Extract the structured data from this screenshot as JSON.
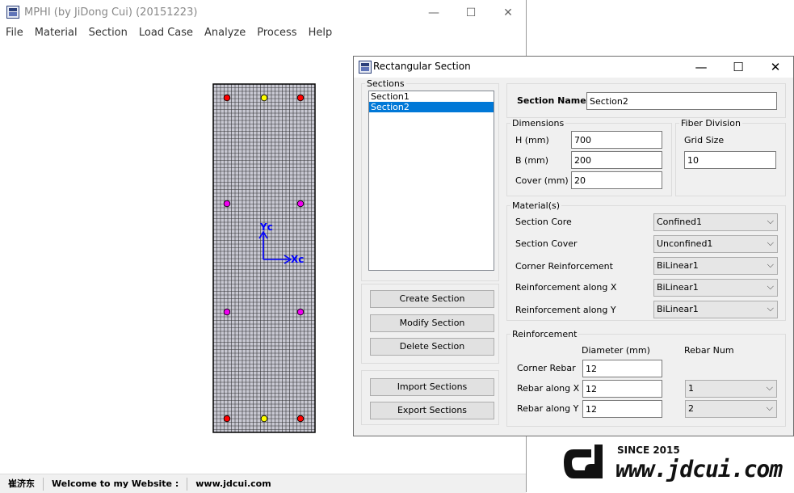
{
  "main_window": {
    "title": "MPHI (by JiDong Cui) (20151223)",
    "controls": {
      "minimize": "—",
      "maximize": "☐",
      "close": "✕"
    },
    "menu": [
      "File",
      "Material",
      "Section",
      "Load Case",
      "Analyze",
      "Process",
      "Help"
    ],
    "canvas": {
      "axis_y_label": "Yc",
      "axis_x_label": "Xc",
      "colors": {
        "concrete": "#c8c8d2",
        "grid": "#000000",
        "corner_rebar": "#ff0000",
        "rebar_x": "#ffff00",
        "rebar_y": "#ee00ee",
        "axis": "#0000ff"
      }
    },
    "status": [
      "崔济东",
      "Welcome to my Website :",
      "www.jdcui.com"
    ]
  },
  "dialog": {
    "title": "Rectangular Section",
    "controls": {
      "minimize": "—",
      "maximize": "☐",
      "close": "✕"
    },
    "sections_group": "Sections",
    "sections": [
      "Section1",
      "Section2"
    ],
    "selected_section_index": 1,
    "buttons": {
      "create": "Create Section",
      "modify": "Modify Section",
      "delete": "Delete Section",
      "import": "Import Sections",
      "export": "Export Sections"
    },
    "section_name_label": "Section Name",
    "section_name_value": "Section2",
    "dimensions": {
      "group": "Dimensions",
      "h_label": "H (mm)",
      "h_value": "700",
      "b_label": "B (mm)",
      "b_value": "200",
      "cover_label": "Cover (mm)",
      "cover_value": "20"
    },
    "fiber": {
      "group": "Fiber Division",
      "grid_label": "Grid Size",
      "grid_value": "10"
    },
    "materials": {
      "group": "Material(s)",
      "rows": [
        {
          "label": "Section Core",
          "value": "Confined1"
        },
        {
          "label": "Section Cover",
          "value": "Unconfined1"
        },
        {
          "label": "Corner Reinforcement",
          "value": "BiLinear1"
        },
        {
          "label": "Reinforcement along X",
          "value": "BiLinear1"
        },
        {
          "label": "Reinforcement along Y",
          "value": "BiLinear1"
        }
      ]
    },
    "reinforcement": {
      "group": "Reinforcement",
      "diameter_header": "Diameter (mm)",
      "num_header": "Rebar Num",
      "corner_label": "Corner Rebar",
      "corner_diameter": "12",
      "x_label": "Rebar along X",
      "x_diameter": "12",
      "x_num": "1",
      "y_label": "Rebar along Y",
      "y_diameter": "12",
      "y_num": "2"
    }
  },
  "logo": {
    "since": "SINCE 2015",
    "url": "www.jdcui.com"
  }
}
